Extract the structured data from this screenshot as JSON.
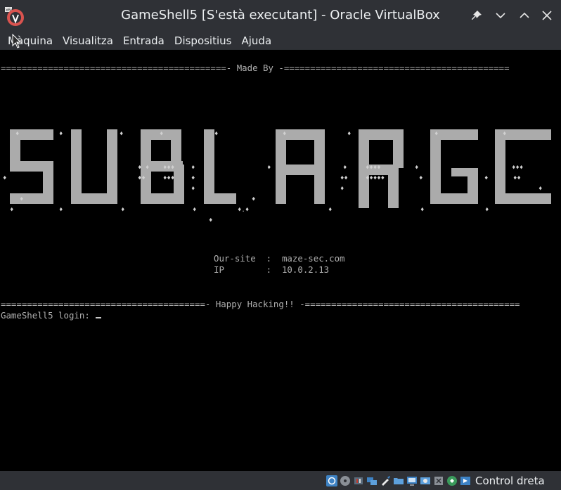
{
  "window": {
    "title": "GameShell5 [S'està executant] - Oracle VirtualBox",
    "app_icon_label": "x64"
  },
  "menubar": {
    "items": [
      "Màquina",
      "Visualitza",
      "Entrada",
      "Dispositius",
      "Ajuda"
    ]
  },
  "terminal": {
    "made_by_line": "===========================================- Made By -===========================================",
    "banner_text": "SUBLARGE",
    "site_line": "Our-site  :  maze-sec.com",
    "ip_line": "IP        :  10.0.2.13",
    "happy_line": "=======================================- Happy Hacking!! -=========================================",
    "login_prompt": "GameShell5 login: "
  },
  "statusbar": {
    "host_key_label": "Control dreta",
    "icons": [
      "disk-icon",
      "optical-drive-icon",
      "audio-icon",
      "network-icon",
      "usb-icon",
      "shared-folder-icon",
      "display-icon",
      "recording-icon",
      "cpu-icon",
      "mouse-integration-icon",
      "host-key-arrow-icon"
    ]
  },
  "colors": {
    "chrome_bg": "#2f3136",
    "terminal_bg": "#000000",
    "terminal_fg": "#b0b0b0",
    "banner_fill": "#ababab"
  }
}
